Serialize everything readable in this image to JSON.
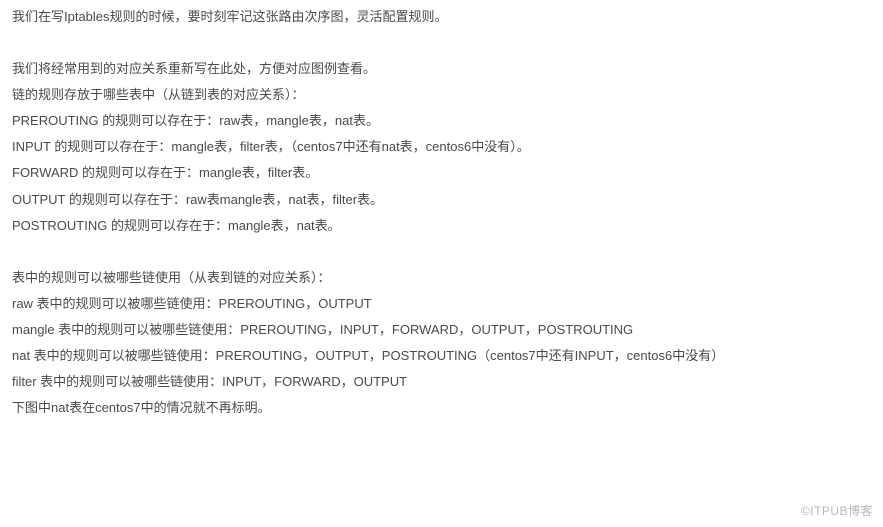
{
  "paragraphs": {
    "intro": "我们在写Iptables规则的时候，要时刻牢记这张路由次序图，灵活配置规则。",
    "chain_lead": "我们将经常用到的对应关系重新写在此处，方便对应图例查看。",
    "chain_header": "链的规则存放于哪些表中（从链到表的对应关系）：",
    "chain_prerouting": "PREROUTING   的规则可以存在于：raw表，mangle表，nat表。",
    "chain_input": "INPUT      的规则可以存在于：mangle表，filter表，（centos7中还有nat表，centos6中没有）。",
    "chain_forward": "FORWARD     的规则可以存在于：mangle表，filter表。",
    "chain_output": "OUTPUT     的规则可以存在于：raw表mangle表，nat表，filter表。",
    "chain_postrouting": "POSTROUTING  的规则可以存在于：mangle表，nat表。",
    "table_header": "表中的规则可以被哪些链使用（从表到链的对应关系）：",
    "table_raw": "raw     表中的规则可以被哪些链使用：PREROUTING，OUTPUT",
    "table_mangle": "mangle  表中的规则可以被哪些链使用：PREROUTING，INPUT，FORWARD，OUTPUT，POSTROUTING",
    "table_nat": "nat     表中的规则可以被哪些链使用：PREROUTING，OUTPUT，POSTROUTING（centos7中还有INPUT，centos6中没有）",
    "table_filter": "filter  表中的规则可以被哪些链使用：INPUT，FORWARD，OUTPUT",
    "note": "下图中nat表在centos7中的情况就不再标明。"
  },
  "watermark": "©ITPUB博客"
}
